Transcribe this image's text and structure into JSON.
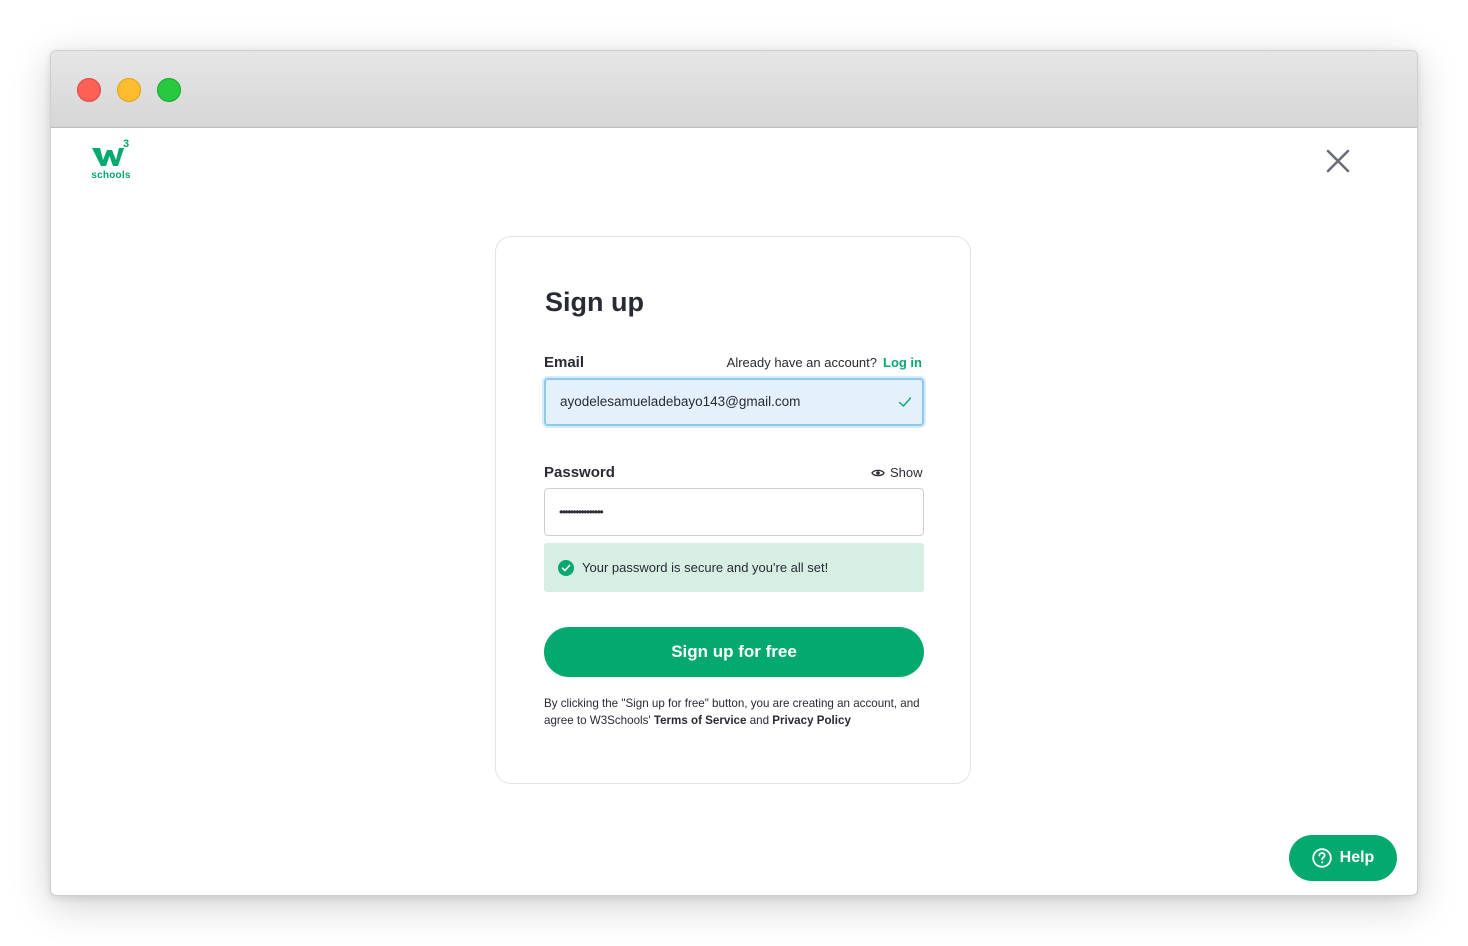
{
  "window": {
    "traffic_lights": [
      "close",
      "minimize",
      "zoom"
    ]
  },
  "brand": {
    "logo_text": "schools",
    "logo_sup": "3",
    "color": "#04aa6d"
  },
  "form": {
    "title": "Sign up",
    "email": {
      "label": "Email",
      "prompt": "Already have an account?",
      "login_link": "Log in",
      "value": "ayodelesamueladebayo143@gmail.com"
    },
    "password": {
      "label": "Password",
      "show_label": "Show",
      "value": "••••••••••••••••"
    },
    "notice": "Your password is secure and you're all set!",
    "submit_label": "Sign up for free",
    "legal": {
      "prefix": "By clicking the \"Sign up for free\" button, you are creating an account, and agree to W3Schools'",
      "terms": "Terms of Service",
      "and": "and",
      "privacy": "Privacy Policy"
    }
  },
  "help": {
    "label": "Help"
  },
  "icons": [
    "close-icon",
    "check-icon",
    "eye-icon",
    "check-circle-icon",
    "help-icon"
  ]
}
